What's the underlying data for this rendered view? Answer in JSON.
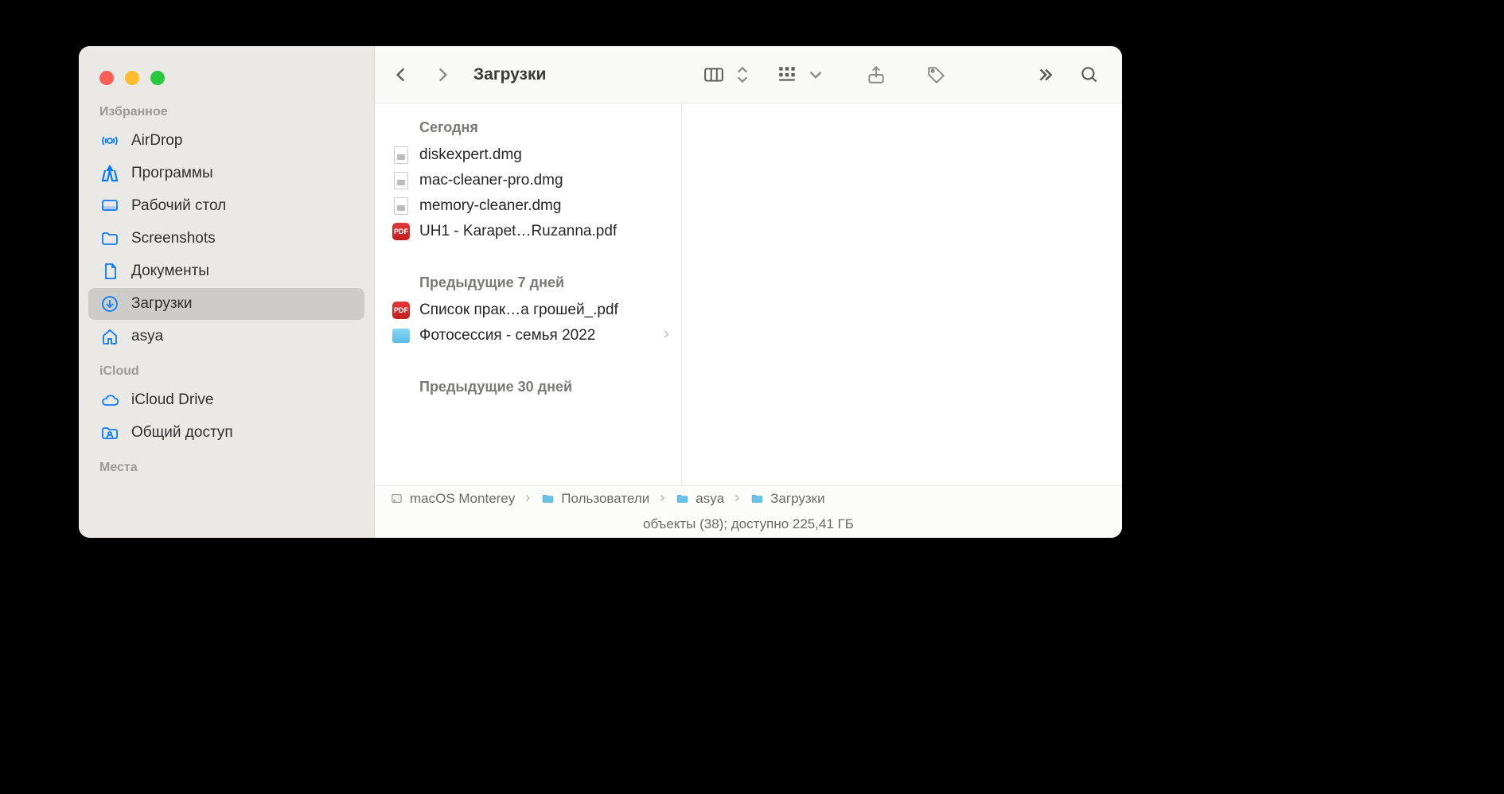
{
  "window": {
    "title": "Загрузки"
  },
  "sidebar": {
    "sections": [
      {
        "label": "Избранное",
        "items": [
          {
            "icon": "airdrop",
            "label": "AirDrop",
            "selected": false
          },
          {
            "icon": "apps",
            "label": "Программы",
            "selected": false
          },
          {
            "icon": "desktop",
            "label": "Рабочий стол",
            "selected": false
          },
          {
            "icon": "folder",
            "label": "Screenshots",
            "selected": false
          },
          {
            "icon": "doc",
            "label": "Документы",
            "selected": false
          },
          {
            "icon": "download",
            "label": "Загрузки",
            "selected": true
          },
          {
            "icon": "home",
            "label": "asya",
            "selected": false
          }
        ]
      },
      {
        "label": "iCloud",
        "items": [
          {
            "icon": "cloud",
            "label": "iCloud Drive",
            "selected": false
          },
          {
            "icon": "shared",
            "label": "Общий доступ",
            "selected": false
          }
        ]
      },
      {
        "label": "Места",
        "items": []
      }
    ]
  },
  "groups": [
    {
      "header": "Сегодня",
      "files": [
        {
          "type": "dmg",
          "name": "diskexpert.dmg",
          "nav": false
        },
        {
          "type": "dmg",
          "name": "mac-cleaner-pro.dmg",
          "nav": false
        },
        {
          "type": "dmg",
          "name": "memory-cleaner.dmg",
          "nav": false
        },
        {
          "type": "pdf",
          "name": "UH1 - Karapet…Ruzanna.pdf",
          "nav": false
        }
      ]
    },
    {
      "header": "Предыдущие 7 дней",
      "files": [
        {
          "type": "pdf",
          "name": "Список прак…а грошей_.pdf",
          "nav": false
        },
        {
          "type": "folder",
          "name": "Фотосессия - семья 2022",
          "nav": true
        }
      ]
    },
    {
      "header": "Предыдущие 30 дней",
      "files": []
    }
  ],
  "path": [
    {
      "icon": "hdd",
      "label": "macOS Monterey"
    },
    {
      "icon": "sysfolder",
      "label": "Пользователи"
    },
    {
      "icon": "sysfolder",
      "label": "asya"
    },
    {
      "icon": "sysfolder",
      "label": "Загрузки"
    }
  ],
  "status": "объекты (38); доступно 225,41 ГБ"
}
